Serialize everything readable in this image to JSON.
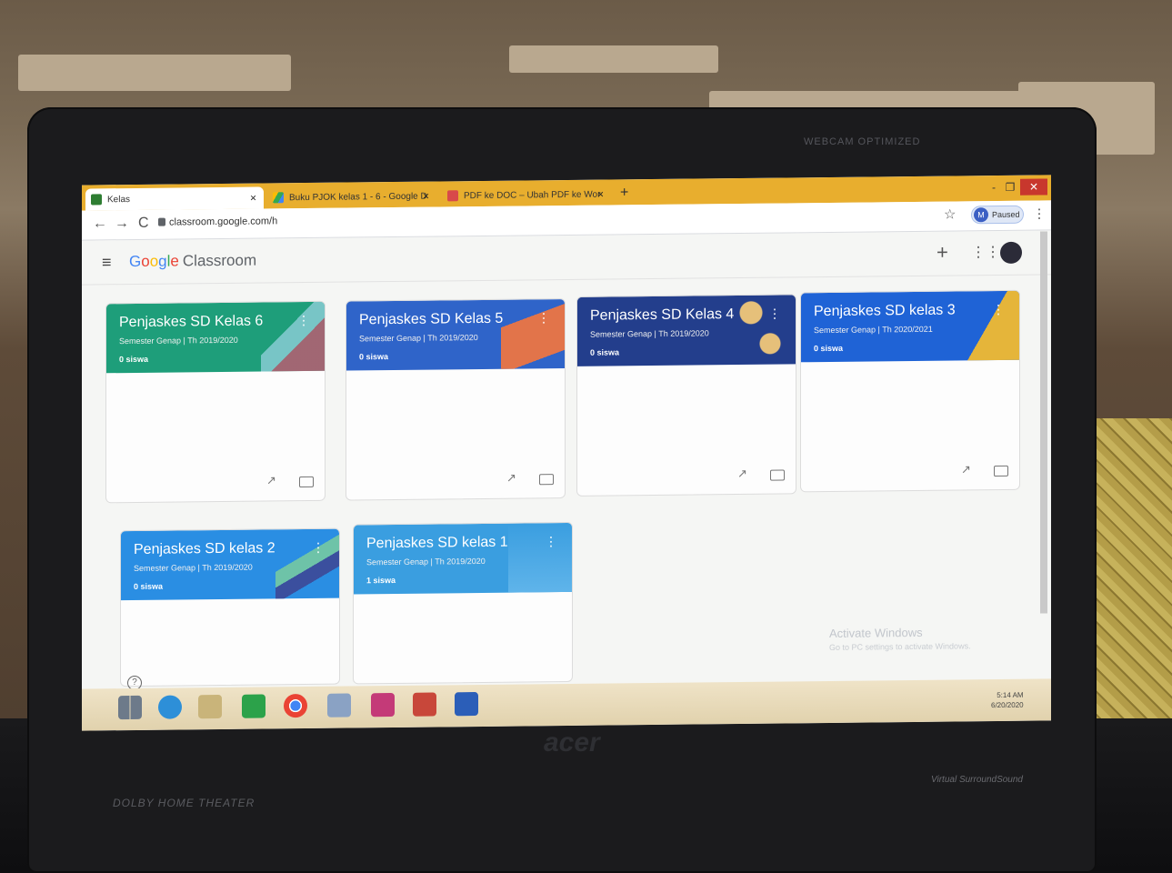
{
  "browser": {
    "tabs": [
      {
        "title": "Kelas",
        "active": true
      },
      {
        "title": "Buku PJOK kelas 1 - 6 - Google D",
        "active": false
      },
      {
        "title": "PDF ke DOC – Ubah PDF ke Wor",
        "active": false
      }
    ],
    "new_tab_label": "+",
    "url": "classroom.google.com/h",
    "profile_initial": "M",
    "profile_status": "Paused",
    "window_controls": {
      "minimize": "-",
      "restore": "❐",
      "close": "✕"
    }
  },
  "app": {
    "logo_google": [
      "G",
      "o",
      "o",
      "g",
      "l",
      "e"
    ],
    "logo_product": "Classroom",
    "add_label": "+"
  },
  "classes": [
    {
      "title": "Penjaskes SD Kelas 6",
      "subtitle": "Semester Genap | Th 2019/2020",
      "students": "0 siswa",
      "color": "#1e9e7a"
    },
    {
      "title": "Penjaskes SD Kelas 5",
      "subtitle": "Semester Genap | Th 2019/2020",
      "students": "0 siswa",
      "color": "#2f64c9"
    },
    {
      "title": "Penjaskes SD Kelas 4",
      "subtitle": "Semester Genap | Th 2019/2020",
      "students": "0 siswa",
      "color": "#233e8c"
    },
    {
      "title": "Penjaskes SD kelas 3",
      "subtitle": "Semester Genap | Th 2020/2021",
      "students": "0 siswa",
      "color": "#1f63d6"
    },
    {
      "title": "Penjaskes SD kelas 2",
      "subtitle": "Semester Genap | Th 2019/2020",
      "students": "0 siswa",
      "color": "#2a8ee3"
    },
    {
      "title": "Penjaskes SD kelas 1",
      "subtitle": "Semester Genap | Th 2019/2020",
      "students": "1 siswa",
      "color": "#3a9ee0"
    }
  ],
  "windows": {
    "activate_title": "Activate Windows",
    "activate_hint": "Go to PC settings to activate Windows."
  },
  "taskbar": {
    "time": "5:14 AM",
    "date": "6/20/2020"
  },
  "hardware": {
    "webcam": "WEBCAM OPTIMIZED",
    "brand": "acer",
    "dolby": "DOLBY HOME THEATER",
    "sound": "Virtual SurroundSound"
  }
}
